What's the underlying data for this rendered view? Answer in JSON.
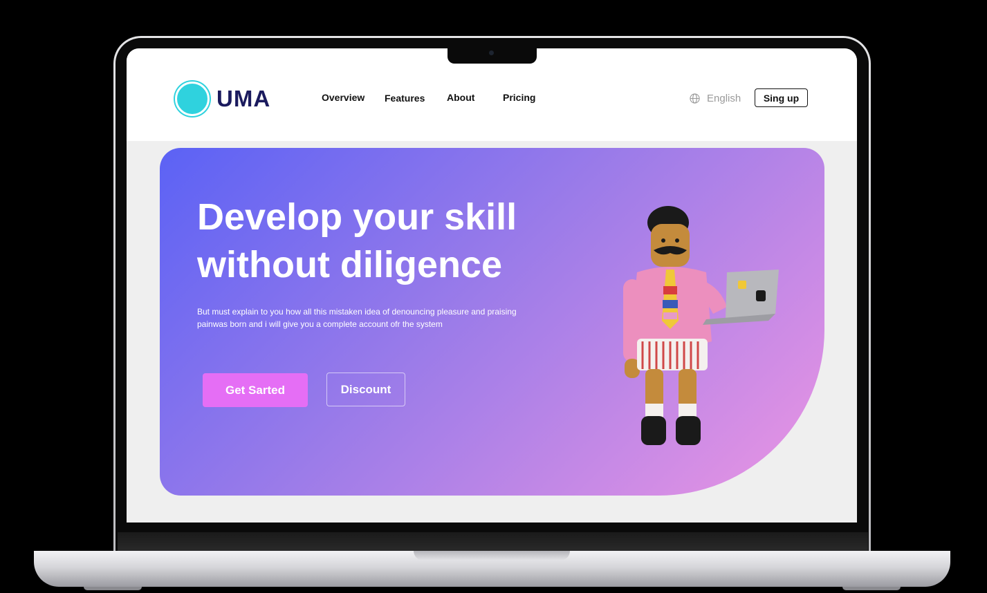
{
  "brand": {
    "name": "UMA",
    "accent": "#2fd2de",
    "text_color": "#1b1b5e"
  },
  "nav": {
    "items": [
      {
        "label": "Overview"
      },
      {
        "label": "Features"
      },
      {
        "label": "About"
      },
      {
        "label": "Pricing"
      }
    ]
  },
  "language": {
    "label": "English",
    "icon": "globe-icon"
  },
  "signup": {
    "label": "Sing up"
  },
  "hero": {
    "headline_line1": "Develop your skill",
    "headline_line2": "without diligence",
    "subtext_line1": "But must explain to you how all this mistaken idea of denouncing pleasure and praising",
    "subtext_line2": "painwas born and i will give you a complete account ofr the system",
    "primary_button": "Get Sarted",
    "secondary_button": "Discount",
    "gradient": [
      "#5b62f5",
      "#9a7be9",
      "#eb95e3"
    ],
    "primary_button_color": "#e56ef5",
    "illustration": "3d-character-with-laptop"
  }
}
